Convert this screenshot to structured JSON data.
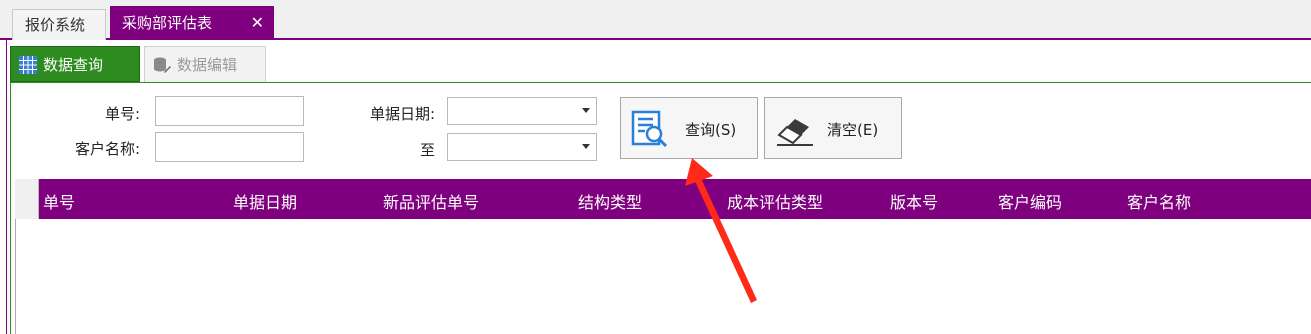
{
  "tabs": [
    {
      "label": "报价系统",
      "active": false
    },
    {
      "label": "采购部评估表",
      "active": true,
      "close_icon": "close-icon"
    }
  ],
  "subtabs": [
    {
      "label": "数据查询",
      "icon": "grid-icon",
      "active": true
    },
    {
      "label": "数据编辑",
      "icon": "database-edit-icon",
      "active": false
    }
  ],
  "form": {
    "order_no_label": "单号:",
    "order_no_value": "",
    "customer_name_label": "客户名称:",
    "customer_name_value": "",
    "doc_date_label": "单据日期:",
    "doc_date_value": "",
    "to_label": "至",
    "to_date_value": ""
  },
  "buttons": {
    "query_label": "查询(S)",
    "query_icon": "search-document-icon",
    "clear_label": "清空(E)",
    "clear_icon": "eraser-icon"
  },
  "grid": {
    "columns": [
      "单号",
      "单据日期",
      "新品评估单号",
      "结构类型",
      "成本评估类型",
      "版本号",
      "客户编码",
      "客户名称"
    ],
    "rows": []
  },
  "colors": {
    "tab_accent": "#7f007f",
    "header_bg": "#7f007f",
    "subtab_active": "#2e8b20",
    "annotation_arrow": "#ff2a1a"
  }
}
